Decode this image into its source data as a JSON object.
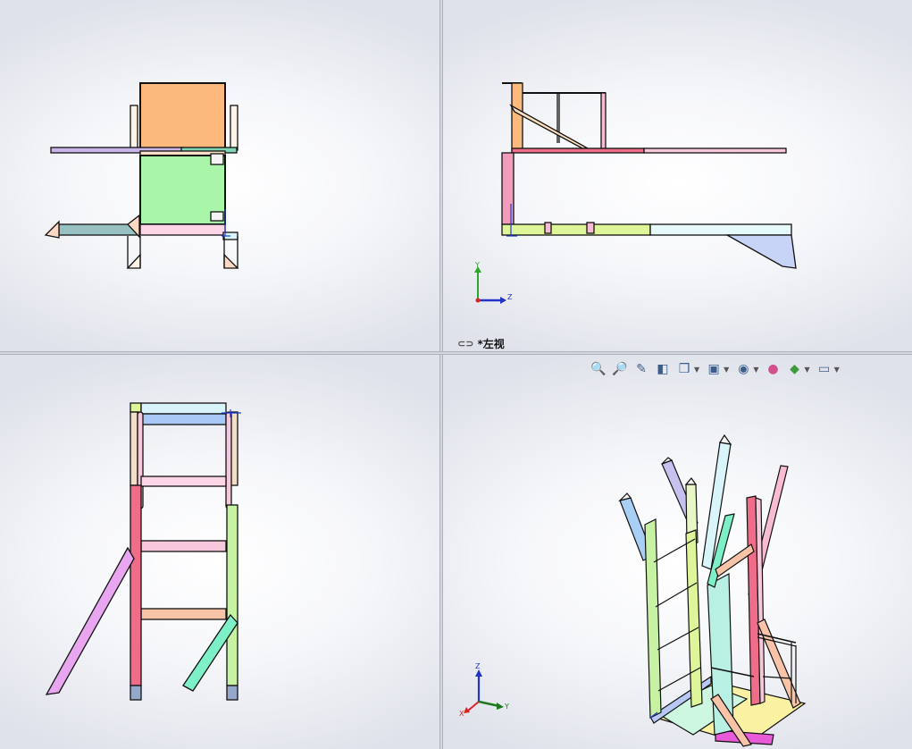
{
  "views": {
    "left_view": {
      "label": "*左视"
    }
  },
  "triad_right": {
    "y": "Y",
    "z": "Z"
  },
  "triad_iso": {
    "z": "Z",
    "y": "Y",
    "x": "X"
  },
  "toolbar": {
    "items": [
      {
        "name": "zoom-to-fit",
        "icon": "zoom-to-fit-icon"
      },
      {
        "name": "zoom-to-area",
        "icon": "zoom-area-icon"
      },
      {
        "name": "previous-view",
        "icon": "previous-view-icon"
      },
      {
        "name": "section-view",
        "icon": "section-view-icon"
      },
      {
        "name": "view-orientation",
        "icon": "view-orientation-icon"
      },
      {
        "name": "display-style",
        "icon": "display-style-icon"
      },
      {
        "name": "hide-show-items",
        "icon": "eye-icon"
      },
      {
        "name": "edit-appearance",
        "icon": "appearance-icon"
      },
      {
        "name": "apply-scene",
        "icon": "scene-icon"
      },
      {
        "name": "view-settings",
        "icon": "monitor-icon"
      }
    ]
  }
}
